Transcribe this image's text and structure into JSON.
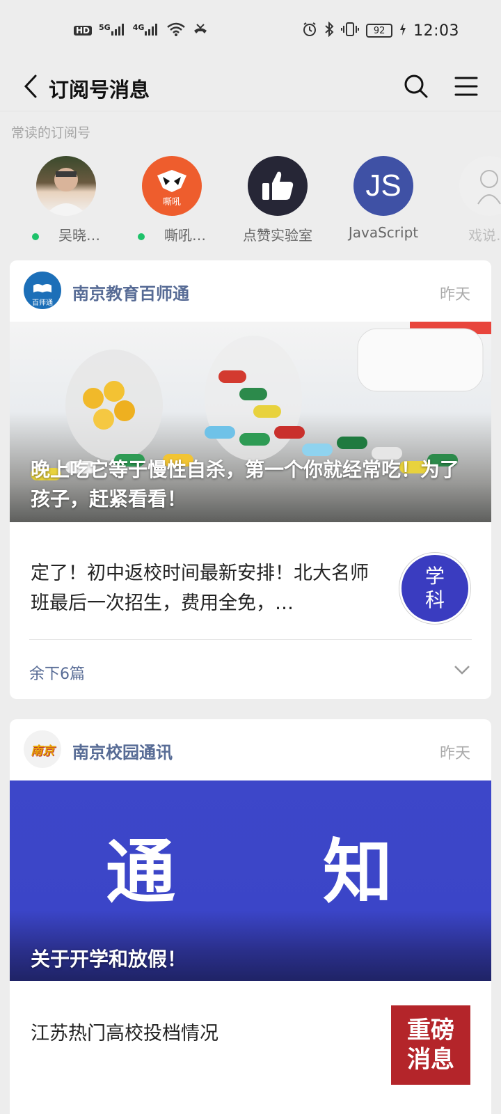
{
  "status": {
    "time": "12:03",
    "battery": "92",
    "net_hd": "HD",
    "net_5g": "5G",
    "net_4g": "4G"
  },
  "nav": {
    "title": "订阅号消息",
    "back_icon": "back-chevron-icon",
    "search_icon": "search-icon",
    "menu_icon": "menu-icon"
  },
  "frequent": {
    "label": "常读的订阅号",
    "items": [
      {
        "name": "吴晓…",
        "unread": true
      },
      {
        "name": "嘶吼…",
        "unread": true,
        "logo_text": "嘶吼"
      },
      {
        "name": "点赞实验室",
        "unread": false
      },
      {
        "name": "JavaScript",
        "unread": false,
        "logo_text": "JS"
      },
      {
        "name": "戏说…",
        "unread": false
      }
    ]
  },
  "cards": [
    {
      "account": "南京教育百师通",
      "logo_text": "百师通",
      "time": "昨天",
      "hero_title": "晚上吃它等于慢性自杀，第一个你就经常吃！为了孩子，赶紧看看！",
      "article": "定了！初中返校时间最新安排！北大名师班最后一次招生，费用全免，…",
      "thumb_text_1": "学",
      "thumb_text_2": "科",
      "more": "余下6篇"
    },
    {
      "account": "南京校园通讯",
      "logo_text": "南京",
      "time": "昨天",
      "hero_big": "通　　知",
      "hero_title": "关于开学和放假！",
      "article": "江苏热门高校投档情况",
      "thumb_text_1": "重磅",
      "thumb_text_2": "消息"
    }
  ],
  "colors": {
    "link": "#576b95",
    "unread_dot": "#1ec26a",
    "notice_blue": "#3b45c8",
    "urgent_red": "#b4252a"
  }
}
